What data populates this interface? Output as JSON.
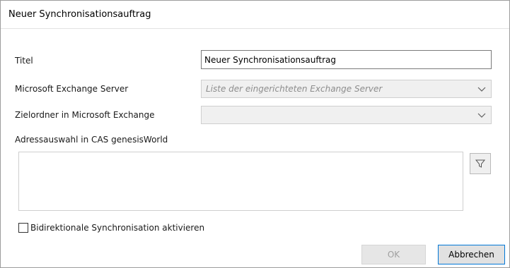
{
  "dialog": {
    "title": "Neuer Synchronisationsauftrag"
  },
  "form": {
    "title_label": "Titel",
    "title_value": "Neuer Synchronisationsauftrag",
    "server_label": "Microsoft Exchange Server",
    "server_value": "Liste der eingerichteten Exchange Server",
    "folder_label": "Zielordner in Microsoft Exchange",
    "folder_value": "",
    "address_label": "Adressauswahl in CAS genesisWorld",
    "bidirectional_label": "Bidirektionale Synchronisation aktivieren",
    "bidirectional_checked": false
  },
  "icons": {
    "filter": "filter-icon",
    "chevron": "chevron-down-icon"
  },
  "buttons": {
    "ok": "OK",
    "cancel": "Abbrechen"
  }
}
